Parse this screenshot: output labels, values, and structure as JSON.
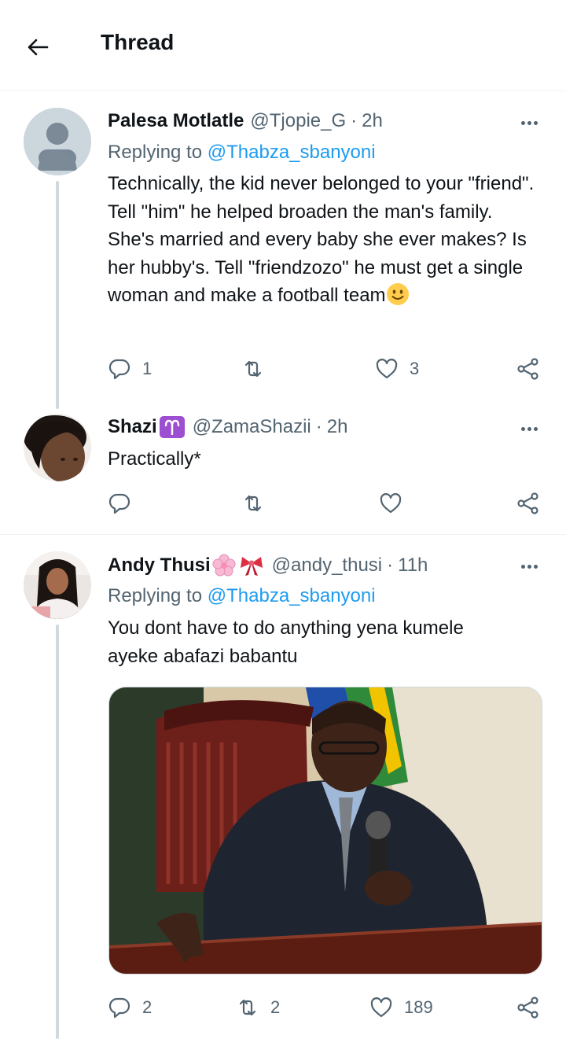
{
  "header": {
    "title": "Thread"
  },
  "tweets": [
    {
      "name": "Palesa Motlatle",
      "handle": "@Tjopie_G",
      "dot": "·",
      "time": "2h",
      "replying_prefix": "Replying to",
      "replying_to": "@Thabza_sbanyoni",
      "text": "Technically, the kid never belonged to your \"friend\". Tell \"him\" he helped broaden the man's family. She's married and every baby she ever makes? Is her hubby's. Tell \"friendzozo\" he must get a single woman and make a football team",
      "emoji": "slightly-smiling-face",
      "replies": "1",
      "retweets": "",
      "likes": "3"
    },
    {
      "name": "Shazi",
      "name_emoji": "♈",
      "handle": "@ZamaShazii",
      "dot": "·",
      "time": "2h",
      "text": "Practically*",
      "replies": "",
      "retweets": "",
      "likes": ""
    },
    {
      "name": "Andy Thusi",
      "name_emoji": "🌸🎀",
      "handle": "@andy_thusi",
      "dot": "·",
      "time": "11h",
      "replying_prefix": "Replying to",
      "replying_to": "@Thabza_sbanyoni",
      "text": "You dont have to do anything yena kumele ayeke abafazi babantu",
      "media": "photo-man-in-suit-pointing-at-table-with-microphone",
      "replies": "2",
      "retweets": "2",
      "likes": "189"
    }
  ],
  "icons": {
    "back": "arrow-left-icon",
    "reply": "reply-icon",
    "retweet": "retweet-icon",
    "like": "heart-icon",
    "share": "share-icon",
    "more": "more-icon"
  },
  "colors": {
    "link": "#1d9bf0",
    "secondary": "#536471",
    "text": "#0f1419",
    "thread_line": "#cfd9de",
    "divider": "#eff3f4"
  }
}
